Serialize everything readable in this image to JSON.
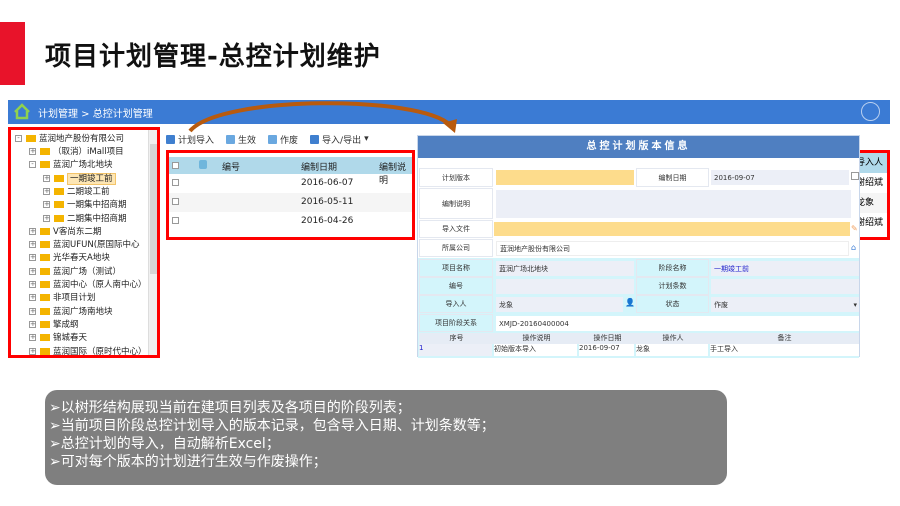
{
  "slide": {
    "title": "项目计划管理-总控计划维护",
    "accent_color": "#e8132a"
  },
  "app": {
    "breadcrumb": "计划管理 > 总控计划管理",
    "tree": {
      "root": "蓝润地产股份有限公司",
      "items": [
        {
          "label": "（取消）iMall项目",
          "level": 1,
          "sign": "+"
        },
        {
          "label": "蓝润广场北地块",
          "level": 1,
          "sign": "-"
        },
        {
          "label": "一期竣工前",
          "level": 2,
          "sign": "+",
          "selected": true
        },
        {
          "label": "二期竣工前",
          "level": 2,
          "sign": "+"
        },
        {
          "label": "一期集中招商期",
          "level": 2,
          "sign": "+"
        },
        {
          "label": "二期集中招商期",
          "level": 2,
          "sign": "+"
        },
        {
          "label": "V客尚东二期",
          "level": 1,
          "sign": "+"
        },
        {
          "label": "蓝润UFUN(原国际中心",
          "level": 1,
          "sign": "+"
        },
        {
          "label": "光华春天A地块",
          "level": 1,
          "sign": "+"
        },
        {
          "label": "蓝润广场（测试）",
          "level": 1,
          "sign": "+"
        },
        {
          "label": "蓝润中心（原人南中心）",
          "level": 1,
          "sign": "+"
        },
        {
          "label": "非项目计划",
          "level": 1,
          "sign": "+"
        },
        {
          "label": "蓝润广场南地块",
          "level": 1,
          "sign": "+"
        },
        {
          "label": "擎成纲",
          "level": 1,
          "sign": "+"
        },
        {
          "label": "锦城春天",
          "level": 1,
          "sign": "+"
        },
        {
          "label": "蓝润国际（原时代中心）",
          "level": 1,
          "sign": "+"
        }
      ]
    },
    "toolbar": [
      "计划导入",
      "生效",
      "作废",
      "导入/导出"
    ],
    "grid": {
      "headers": [
        "编号",
        "编制日期",
        "编制说明"
      ],
      "rows": [
        "2016-06-07",
        "2016-05-11",
        "2016-04-26"
      ]
    },
    "right_column": [
      "导入人",
      "谢绍斌",
      "龙象",
      "谢绍斌"
    ],
    "dialog": {
      "title": "总控计划版本信息",
      "plan_version_label": "计划版本",
      "plan_version": "",
      "edit_date_label": "编制日期",
      "edit_date": "2016-09-07",
      "desc_label": "编制说明",
      "file_label": "导入文件",
      "company_label": "所属公司",
      "company": "蓝润地产股份有限公司",
      "project_label": "项目名称",
      "project": "蓝润广场北地块",
      "stage_label": "阶段名称",
      "stage": "一期竣工前",
      "code_label": "编号",
      "count_label": "计划条数",
      "importer_label": "导入人",
      "importer": "龙象",
      "status_label": "状态",
      "status": "作废",
      "relation_label": "项目阶段关系",
      "relation": "XMJD-20160400004",
      "log_headers": [
        "序号",
        "操作说明",
        "操作日期",
        "操作人",
        "备注"
      ],
      "log_row": [
        "1",
        "初始版本导入",
        "2016-09-07",
        "龙象",
        "手工导入"
      ]
    }
  },
  "notes": [
    "➢以树形结构展现当前在建项目列表及各项目的阶段列表；",
    "➢当前项目阶段总控计划导入的版本记录，包含导入日期、计划条数等；",
    "➢总控计划的导入，自动解析Excel；",
    "➢可对每个版本的计划进行生效与作废操作；"
  ]
}
